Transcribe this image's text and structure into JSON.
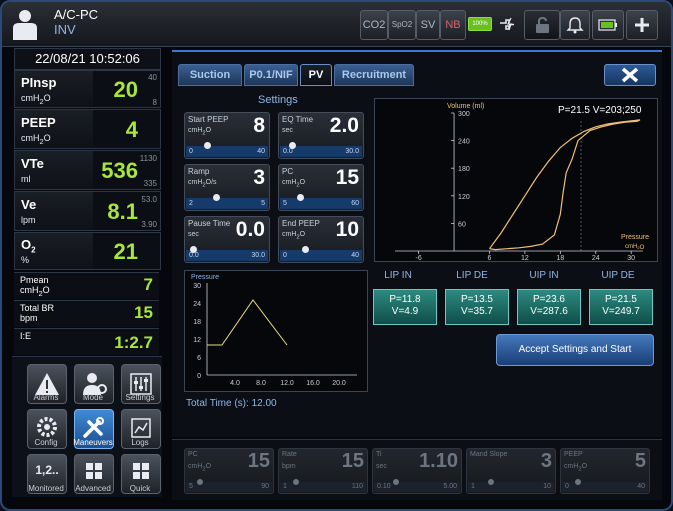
{
  "header": {
    "mode": "A/C-PC",
    "submode": "INV",
    "status_buttons": [
      "CO2",
      "SpO2",
      "SV",
      "NB"
    ],
    "battery": "100%"
  },
  "left_panel": {
    "datetime": "22/08/21 10:52:06",
    "params": [
      {
        "name": "PInsp",
        "unit": "cmH2O",
        "value": "20",
        "high": "40",
        "low": "8"
      },
      {
        "name": "PEEP",
        "unit": "cmH2O",
        "value": "4",
        "high": "",
        "low": ""
      },
      {
        "name": "VTe",
        "unit": "ml",
        "value": "536",
        "high": "1130",
        "low": "335"
      },
      {
        "name": "Ve",
        "unit": "lpm",
        "value": "8.1",
        "high": "53.0",
        "low": "3.90"
      },
      {
        "name": "O2",
        "unit": "%",
        "value": "21",
        "high": "",
        "low": ""
      }
    ],
    "small_params": [
      {
        "name": "Pmean",
        "unit": "cmH2O",
        "value": "7"
      },
      {
        "name": "Total BR",
        "unit": "bpm",
        "value": "15"
      },
      {
        "name": "I:E",
        "unit": "",
        "value": "1:2.7"
      }
    ]
  },
  "nav": {
    "buttons": [
      {
        "label": "Alarms"
      },
      {
        "label": "Mode"
      },
      {
        "label": "Settings"
      },
      {
        "label": "Config"
      },
      {
        "label": "Maneuvers"
      },
      {
        "label": "Logs"
      },
      {
        "label": "Monitored"
      },
      {
        "label": "Advanced"
      },
      {
        "label": "Quick"
      }
    ],
    "monitored_icon_text": "1,2.."
  },
  "tabs": [
    "Suction",
    "P0.1/NIF",
    "PV",
    "Recruitment"
  ],
  "active_tab": "PV",
  "settings": {
    "title": "Settings",
    "items": [
      {
        "name": "Start PEEP",
        "unit": "cmH2O",
        "value": "8",
        "min": "0",
        "max": "40",
        "level": 0.2
      },
      {
        "name": "EQ Time",
        "unit": "sec",
        "value": "2.0",
        "min": "0.0",
        "max": "30.0",
        "level": 0.07
      },
      {
        "name": "Ramp",
        "unit": "cmH2O/s",
        "value": "3",
        "min": "2",
        "max": "5",
        "level": 0.33
      },
      {
        "name": "PC",
        "unit": "cmH2O",
        "value": "15",
        "min": "5",
        "max": "60",
        "level": 0.18
      },
      {
        "name": "Pause Time",
        "unit": "sec",
        "value": "0.0",
        "min": "0.0",
        "max": "30.0",
        "level": 0.0
      },
      {
        "name": "End PEEP",
        "unit": "cmH2O",
        "value": "10",
        "min": "0",
        "max": "40",
        "level": 0.25
      }
    ]
  },
  "pressure_chart": {
    "label": "Pressure",
    "y_ticks": [
      "30",
      "24",
      "18",
      "12",
      "6",
      "0"
    ],
    "x_ticks": [
      "4.0",
      "8.0",
      "12.0",
      "16.0",
      "20.0"
    ],
    "total_time": "Total Time (s): 12.00"
  },
  "chart_data": {
    "type": "line",
    "title": "",
    "x_label": "Pressure cmH2O",
    "y_label": "Volume (ml)",
    "readout": "P=21.5 V=203;250",
    "xlim": [
      -10,
      32
    ],
    "ylim": [
      0,
      300
    ],
    "x_ticks": [
      "-6",
      "6",
      "12",
      "18",
      "24",
      "30"
    ],
    "y_ticks": [
      "300",
      "240",
      "180",
      "120",
      "60"
    ],
    "series": [
      {
        "color": "#f0c070",
        "x": [
          6,
          8,
          9.5,
          11,
          12,
          13,
          14,
          16,
          18,
          20,
          22,
          24,
          26,
          28,
          30,
          31.5,
          31,
          29,
          27,
          25,
          23,
          21,
          20,
          19,
          18.5,
          18,
          17,
          15,
          13,
          11,
          9,
          7,
          6
        ],
        "y": [
          5,
          40,
          70,
          100,
          120,
          140,
          160,
          195,
          225,
          245,
          260,
          270,
          276,
          280,
          283,
          285,
          282,
          280,
          276,
          270,
          262,
          240,
          200,
          170,
          130,
          80,
          35,
          15,
          10,
          7,
          5,
          3,
          5
        ]
      }
    ]
  },
  "lip": {
    "headers": [
      "LIP IN",
      "LIP DE",
      "UIP IN",
      "UIP DE"
    ],
    "boxes": [
      {
        "p": "P=11.8",
        "v": "V=4.9"
      },
      {
        "p": "P=13.5",
        "v": "V=35.7"
      },
      {
        "p": "P=23.6",
        "v": "V=287.6"
      },
      {
        "p": "P=21.5",
        "v": "V=249.7"
      }
    ]
  },
  "accept_label": "Accept Settings and Start",
  "bottom_settings": [
    {
      "name": "PC",
      "unit": "cmH2O",
      "value": "15",
      "min": "5",
      "max": "90",
      "level": 0.1
    },
    {
      "name": "Rate",
      "unit": "bpm",
      "value": "15",
      "min": "1",
      "max": "110",
      "level": 0.12
    },
    {
      "name": "Ti",
      "unit": "sec",
      "value": "1.10",
      "min": "0.10",
      "max": "5.00",
      "level": 0.2
    },
    {
      "name": "Mand Slope",
      "unit": "",
      "value": "3",
      "min": "1",
      "max": "10",
      "level": 0.22
    },
    {
      "name": "PEEP",
      "unit": "cmH2O",
      "value": "5",
      "min": "0",
      "max": "40",
      "level": 0.12
    }
  ]
}
